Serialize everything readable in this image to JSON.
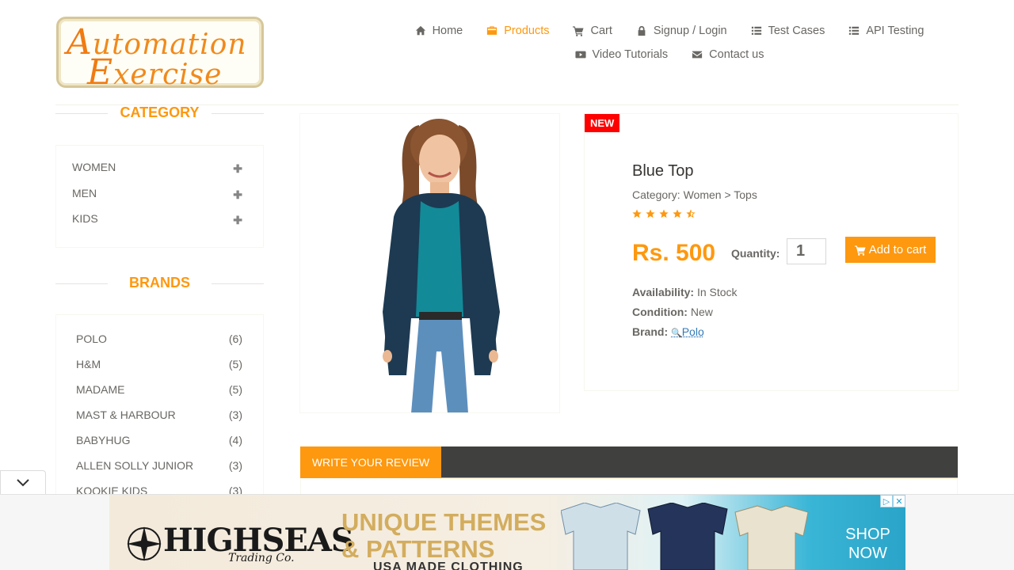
{
  "logo": {
    "line1_cap": "A",
    "line1_rest": "utomation",
    "line2_cap": "E",
    "line2_rest": "xercise"
  },
  "nav": {
    "items": [
      {
        "label": "Home",
        "icon": "home-icon"
      },
      {
        "label": "Products",
        "icon": "products-icon",
        "active": true
      },
      {
        "label": "Cart",
        "icon": "cart-icon"
      },
      {
        "label": "Signup / Login",
        "icon": "lock-icon"
      },
      {
        "label": "Test Cases",
        "icon": "list-icon"
      },
      {
        "label": "API Testing",
        "icon": "list-icon"
      },
      {
        "label": "Video Tutorials",
        "icon": "youtube-icon"
      },
      {
        "label": "Contact us",
        "icon": "envelope-icon"
      }
    ]
  },
  "sidebar": {
    "category_title": "CATEGORY",
    "categories": [
      {
        "label": "WOMEN"
      },
      {
        "label": "MEN"
      },
      {
        "label": "KIDS"
      }
    ],
    "brands_title": "BRANDS",
    "brands": [
      {
        "label": "POLO",
        "count": "(6)"
      },
      {
        "label": "H&M",
        "count": "(5)"
      },
      {
        "label": "MADAME",
        "count": "(5)"
      },
      {
        "label": "MAST & HARBOUR",
        "count": "(3)"
      },
      {
        "label": "BABYHUG",
        "count": "(4)"
      },
      {
        "label": "ALLEN SOLLY JUNIOR",
        "count": "(3)"
      },
      {
        "label": "KOOKIE KIDS",
        "count": "(3)"
      }
    ]
  },
  "product": {
    "badge": "NEW",
    "name": "Blue Top",
    "category": "Category: Women > Tops",
    "rating": 4.5,
    "price": "Rs. 500",
    "quantity_label": "Quantity:",
    "quantity_value": "1",
    "add_to_cart": "Add to cart",
    "availability_label": "Availability:",
    "availability_value": "In Stock",
    "condition_label": "Condition:",
    "condition_value": "New",
    "brand_label": "Brand:",
    "brand_value": "Polo"
  },
  "review": {
    "tab_label": "WRITE YOUR REVIEW"
  },
  "ad": {
    "brand": "HIGHSEAS",
    "brand_sub": "Trading Co.",
    "headline_1": "UNIQUE THEMES",
    "headline_2": "& PATTERNS",
    "tagline": "USA MADE CLOTHING",
    "cta_1": "SHOP",
    "cta_2": "NOW",
    "colors": {
      "gold": "#d3ad5e",
      "sea": "#2aa4c8"
    }
  },
  "colors": {
    "accent": "#fe980f",
    "text": "#696763",
    "badge": "#ff0000",
    "bar": "#40403e"
  }
}
